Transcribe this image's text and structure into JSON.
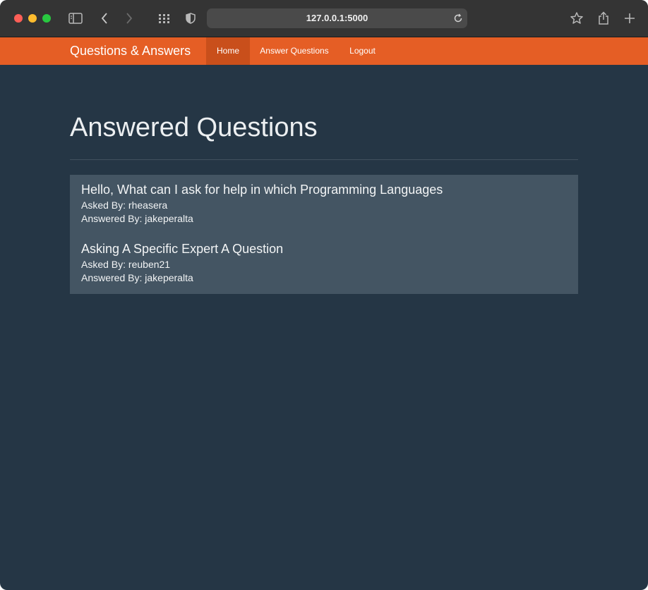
{
  "browser": {
    "url": "127.0.0.1:5000"
  },
  "navbar": {
    "brand": "Questions & Answers",
    "items": [
      {
        "label": "Home",
        "active": true
      },
      {
        "label": "Answer Questions",
        "active": false
      },
      {
        "label": "Logout",
        "active": false
      }
    ]
  },
  "main": {
    "title": "Answered Questions",
    "questions": [
      {
        "title": "Hello, What can I ask for help in which Programming Languages",
        "asked_by": "Asked By: rheasera",
        "answered_by": "Answered By: jakeperalta"
      },
      {
        "title": "Asking A Specific Expert A Question",
        "asked_by": "Asked By: reuben21",
        "answered_by": "Answered By: jakeperalta"
      }
    ]
  },
  "colors": {
    "navbar": "#e55e25",
    "navbar_active": "#c94f1b",
    "page_background": "#253645",
    "panel": "#445563"
  }
}
